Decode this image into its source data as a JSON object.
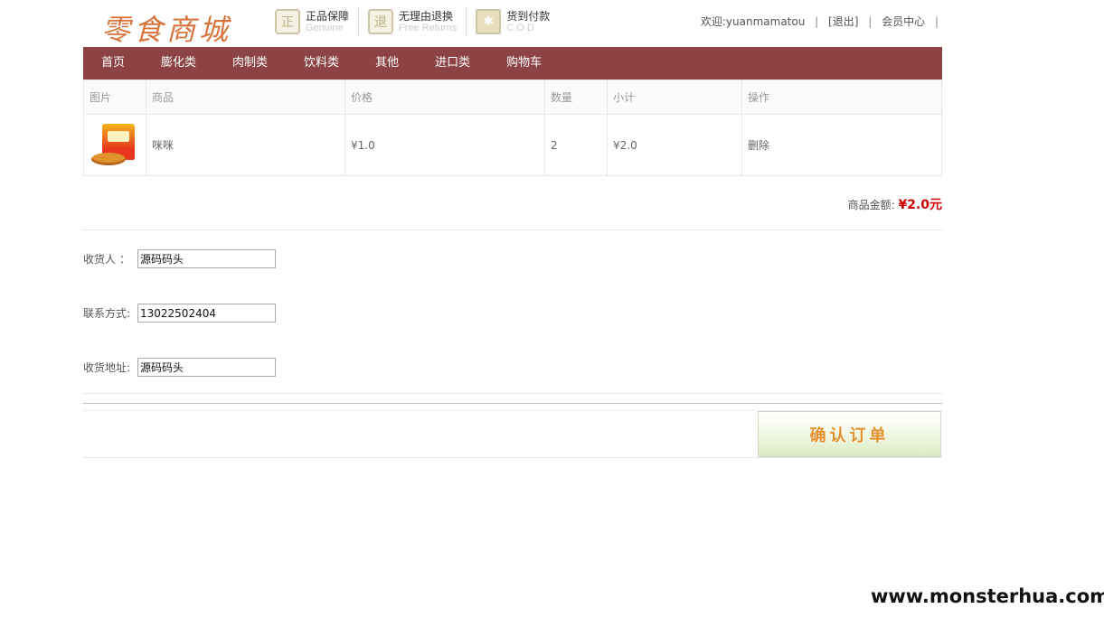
{
  "header": {
    "logo": "零食商城",
    "badges": [
      {
        "title": "正品保障",
        "sub": "Genuine",
        "icon_glyph": "正"
      },
      {
        "title": "无理由退换",
        "sub": "Free Returns",
        "icon_glyph": "退"
      },
      {
        "title": "货到付款",
        "sub": "C.O.D",
        "icon_glyph": "✱"
      }
    ],
    "user": {
      "welcome": "欢迎:yuanmamatou",
      "logout": "[退出]",
      "member_center": "会员中心",
      "sep": "|"
    }
  },
  "nav": {
    "items": [
      "首页",
      "膨化类",
      "肉制类",
      "饮料类",
      "其他",
      "进口类",
      "购物车"
    ]
  },
  "cart": {
    "headers": [
      "图片",
      "商品",
      "价格",
      "数量",
      "小计",
      "操作"
    ],
    "rows": [
      {
        "name": "咪咪",
        "price": "¥1.0",
        "qty": "2",
        "subtotal": "¥2.0",
        "action": "删除"
      }
    ],
    "total_label": "商品金额:",
    "total_value": "¥2.0元"
  },
  "form": {
    "receiver_label": "收货人  ：",
    "receiver_value": "源码码头",
    "phone_label": "联系方式:",
    "phone_value": "13022502404",
    "address_label": "收货地址:",
    "address_value": "源码码头"
  },
  "confirm_label": "确认订单",
  "watermark": "www.monsterhua.com",
  "colors": {
    "nav_bg": "#8b4443",
    "total_price": "#d10000",
    "logo": "#d8733b",
    "confirm_text": "#e4902c"
  }
}
